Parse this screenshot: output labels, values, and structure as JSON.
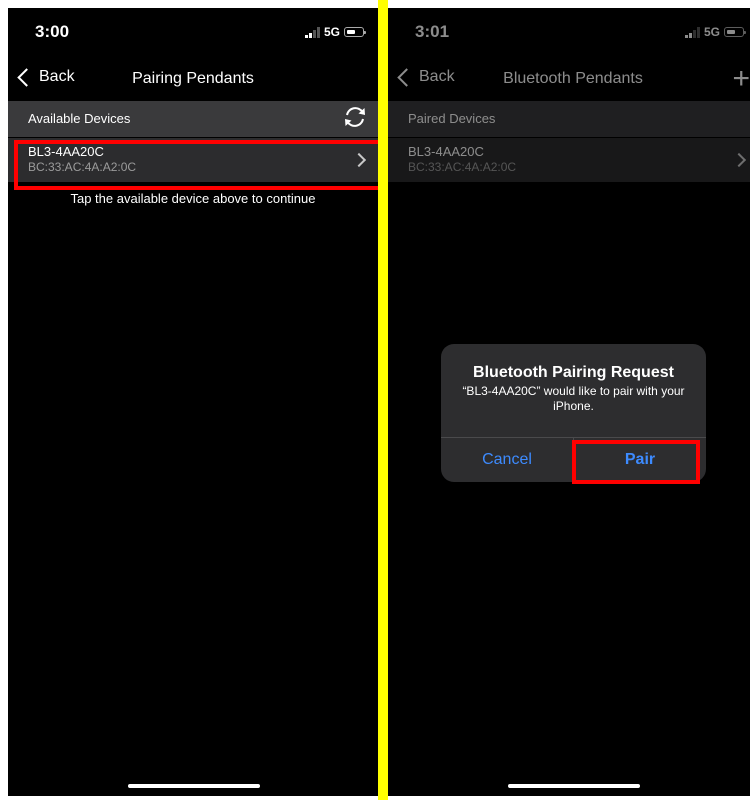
{
  "left_screen": {
    "status_time": "3:00",
    "network": "5G",
    "back_label": "Back",
    "title": "Pairing Pendants",
    "section_label": "Available Devices",
    "device": {
      "name": "BL3-4AA20C",
      "mac": "BC:33:AC:4A:A2:0C"
    },
    "hint": "Tap the available device above to continue"
  },
  "right_screen": {
    "status_time": "3:01",
    "network": "5G",
    "back_label": "Back",
    "title": "Bluetooth Pendants",
    "add_label": "+",
    "section_label": "Paired Devices",
    "device": {
      "name": "BL3-4AA20C",
      "mac": "BC:33:AC:4A:A2:0C"
    },
    "alert": {
      "title": "Bluetooth Pairing Request",
      "message": "“BL3-4AA20C” would like to pair with your iPhone.",
      "cancel_label": "Cancel",
      "pair_label": "Pair"
    }
  },
  "colors": {
    "background": "#000000",
    "divider": "#ffff00",
    "highlight": "#ff0000",
    "accent": "#3d8bff",
    "section_bg": "#3a3a3c",
    "row_bg": "#2c2c2e"
  }
}
